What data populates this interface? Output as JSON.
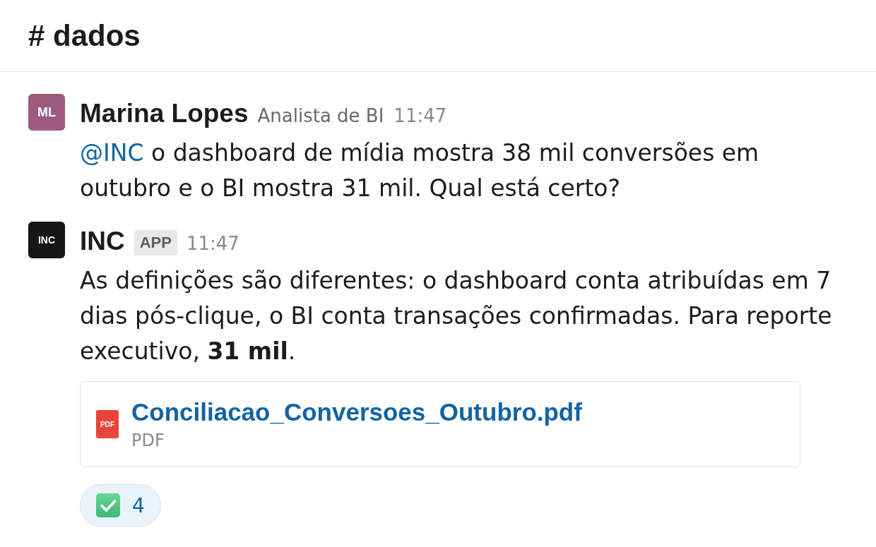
{
  "channel": {
    "title": "# dados"
  },
  "messages": [
    {
      "avatar": {
        "initials": "ML",
        "color": "#9b5a7e"
      },
      "author": "Marina Lopes",
      "role": "Analista de BI",
      "time": "11:47",
      "mention": "@INC",
      "text": "o dashboard de mídia mostra 38 mil conversões em outubro e o BI mostra 31 mil. Qual está certo?"
    },
    {
      "avatar": {
        "initials": "INC",
        "color": "#161616"
      },
      "author": "INC",
      "badge": "APP",
      "time": "11:47",
      "text": "As definições são diferentes: o dashboard conta atribuídas em 7 dias pós-clique, o BI conta transações confirmadas. Para reporte executivo, **31 mil**.",
      "attachments": [
        {
          "icon_text": "PDF",
          "name": "Conciliacao_Conversoes_Outubro.pdf",
          "type_label": "PDF"
        }
      ],
      "reactions": [
        {
          "count": "4",
          "selected": true
        }
      ]
    }
  ]
}
